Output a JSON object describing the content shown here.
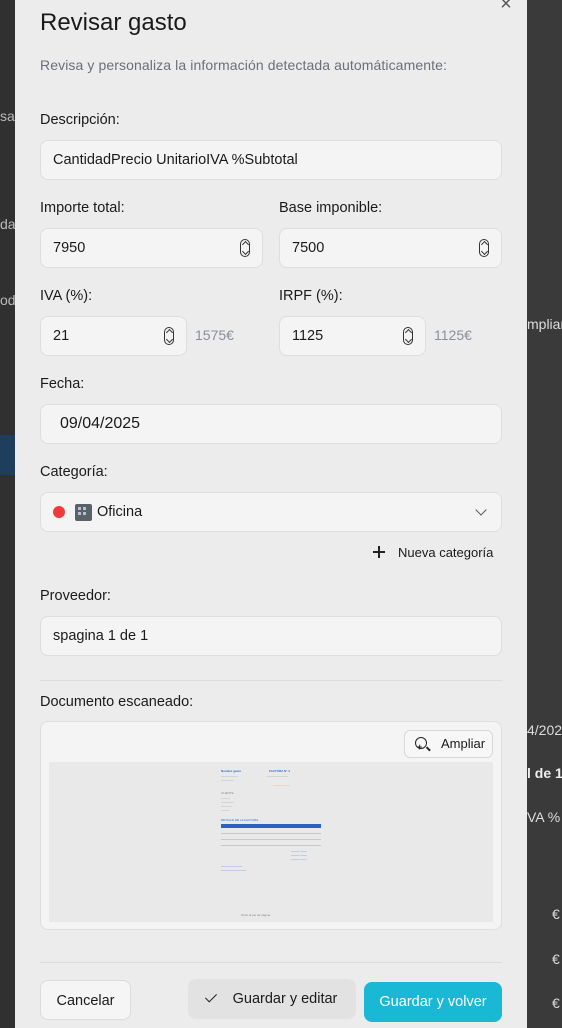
{
  "background": {
    "fragments": [
      "sar",
      "da",
      "od",
      "mpliar",
      "4/202",
      "l de 1",
      "VA %",
      "€",
      "€",
      "€"
    ]
  },
  "modal": {
    "title": "Revisar gasto",
    "subtitle": "Revisa y personaliza la información detectada automáticamente:",
    "close_icon": "close-icon"
  },
  "form": {
    "description": {
      "label": "Descripción:",
      "value": "CantidadPrecio UnitarioIVA %Subtotal"
    },
    "total": {
      "label": "Importe total:",
      "value": "7950"
    },
    "base": {
      "label": "Base imponible:",
      "value": "7500"
    },
    "iva": {
      "label": "IVA (%):",
      "value": "21",
      "amount": "1575€"
    },
    "irpf": {
      "label": "IRPF (%):",
      "value": "1125",
      "amount": "1125€"
    },
    "date": {
      "label": "Fecha:",
      "value": "09/04/2025"
    },
    "category": {
      "label": "Categoría:",
      "value": "Oficina",
      "dot_color": "#f03a3a",
      "icon": "office-building-icon"
    },
    "new_category": "Nueva categoría",
    "provider": {
      "label": "Proveedor:",
      "value": "spagina 1 de 1"
    }
  },
  "document": {
    "label": "Documento escaneado:",
    "zoom_label": "Ampliar",
    "thumbnail": {
      "company": "Nombre gasto",
      "invoice": "FACTURA Nº 4",
      "client_label": "CLIENTE",
      "section": "DETALLE DE LA FACTURA",
      "footer": "Texto al pie de página"
    }
  },
  "actions": {
    "cancel": "Cancelar",
    "save_edit": "Guardar y editar",
    "save_back": "Guardar y volver"
  },
  "colors": {
    "accent": "#19b8d4",
    "category_dot": "#f03a3a"
  }
}
